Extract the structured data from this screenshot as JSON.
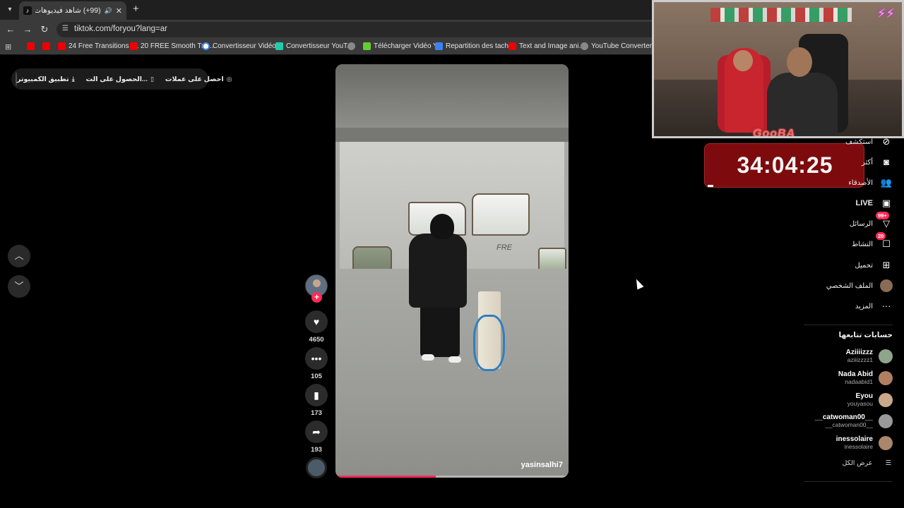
{
  "browser": {
    "tab_title": "(99+) شاهد فيديوهات متصدرة",
    "tab_favicon": "tiktok-logo",
    "url": "tiktok.com/foryou?lang=ar",
    "bookmarks": [
      {
        "label": "",
        "icon": "youtube-icon"
      },
      {
        "label": "",
        "icon": "youtube-icon"
      },
      {
        "label": "24 Free Transitions f...",
        "icon": "youtube-icon"
      },
      {
        "label": "20 FREE Smooth Tra...",
        "icon": "youtube-icon"
      },
      {
        "label": "Convertisseur Vidéo...",
        "icon": "google-icon"
      },
      {
        "label": "Convertisseur YouT...",
        "icon": "converter-icon"
      },
      {
        "label": "",
        "icon": "globe-icon"
      },
      {
        "label": "Télécharger Vidéo Y...",
        "icon": "download-icon"
      },
      {
        "label": "Repartition des tach...",
        "icon": "docs-icon"
      },
      {
        "label": "Text and Image ani...",
        "icon": "youtube-icon"
      },
      {
        "label": "YouTube Converter...",
        "icon": "globe-icon"
      }
    ]
  },
  "top_pill": {
    "coins": "احصل على عملات",
    "app": "الحصول على الت...",
    "desktop": "تطبيق الكمبيوتر"
  },
  "video": {
    "username": "yasinsalhi7",
    "graffiti": "FRE",
    "progress": 0.43
  },
  "actions": {
    "likes": "4650",
    "comments": "105",
    "saves": "173",
    "shares": "193"
  },
  "overlay": {
    "brand": "GooBA",
    "timer": "34:04:25"
  },
  "sidebar": {
    "items": [
      {
        "label": "استكشف",
        "icon": "compass-icon"
      },
      {
        "label": "أكثر",
        "icon": "profile-card-icon"
      },
      {
        "label": "الأصدقاء",
        "icon": "friends-icon"
      },
      {
        "label": "LIVE",
        "icon": "live-icon"
      },
      {
        "label": "الرسائل",
        "icon": "messages-icon",
        "badge": "99+"
      },
      {
        "label": "النشاط",
        "icon": "activity-icon",
        "badge": "20"
      },
      {
        "label": "تحميل",
        "icon": "upload-icon"
      },
      {
        "label": "الملف الشخصي",
        "icon": "avatar"
      },
      {
        "label": "المزيد",
        "icon": "more-icon"
      }
    ],
    "following_heading": "حسابات تتابعها",
    "accounts": [
      {
        "name": "Aziiiizzz",
        "handle": "aziiizzzz1",
        "color": "#8fa58a"
      },
      {
        "name": "Nada Abid",
        "handle": "nadaabid1",
        "color": "#b07f62"
      },
      {
        "name": "Eyou",
        "handle": "youyasou",
        "color": "#c9a98a"
      },
      {
        "name": "__catwoman00__",
        "handle": "__catwoman00__",
        "color": "#9a9a9a"
      },
      {
        "name": "inessolaire",
        "handle": "inessolaire",
        "color": "#a9876c"
      }
    ],
    "see_all": "عرض الكل"
  },
  "colors": {
    "accent": "#fe2c55",
    "timer_bg": "#7d0a0d",
    "rope": "#2f7fc1"
  }
}
